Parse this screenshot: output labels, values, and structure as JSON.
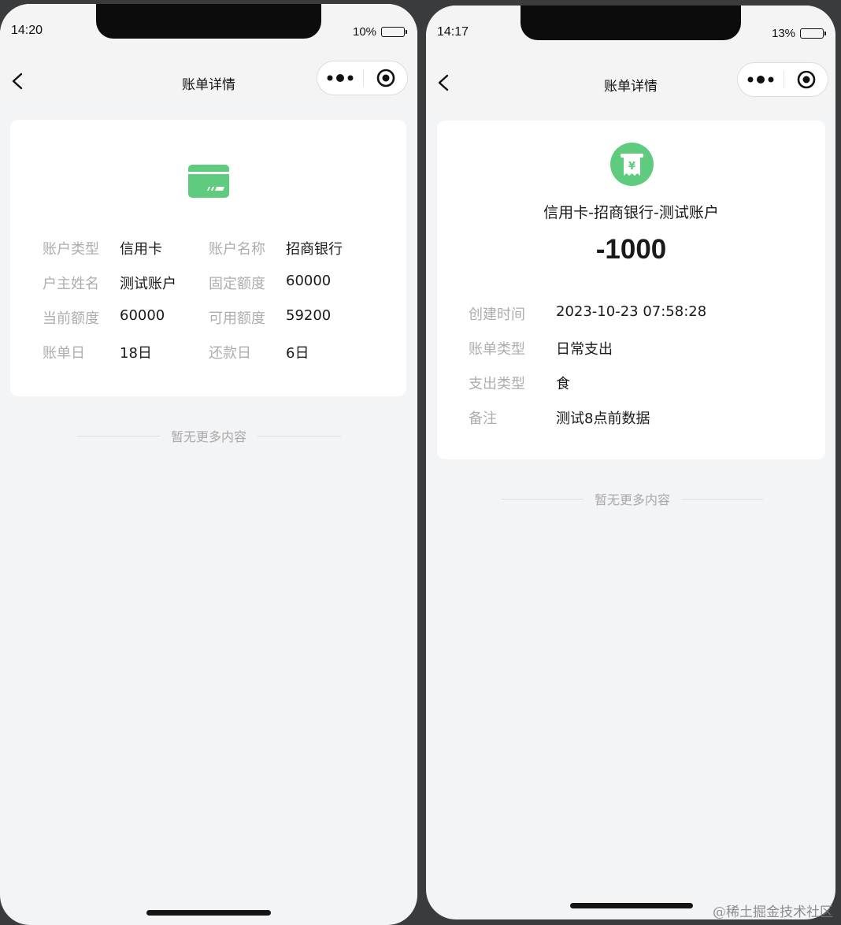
{
  "left": {
    "status": {
      "time": "14:20",
      "battery_pct": "10%",
      "battery_level": 0.1
    },
    "nav": {
      "title": "账单详情"
    },
    "card_icon": "credit-card-icon",
    "info": [
      {
        "label": "账户类型",
        "value": "信用卡"
      },
      {
        "label": "账户名称",
        "value": "招商银行"
      },
      {
        "label": "户主姓名",
        "value": "测试账户"
      },
      {
        "label": "固定额度",
        "value": "60000"
      },
      {
        "label": "当前额度",
        "value": "60000"
      },
      {
        "label": "可用额度",
        "value": "59200"
      },
      {
        "label": "账单日",
        "value": "18日"
      },
      {
        "label": "还款日",
        "value": "6日"
      }
    ],
    "footer": "暂无更多内容"
  },
  "right": {
    "status": {
      "time": "14:17",
      "battery_pct": "13%",
      "battery_level": 0.13
    },
    "nav": {
      "title": "账单详情"
    },
    "bill_icon": "yen-receipt-icon",
    "account_name": "信用卡-招商银行-测试账户",
    "amount": "-1000",
    "info": [
      {
        "label": "创建时间",
        "value": "2023-10-23 07:58:28"
      },
      {
        "label": "账单类型",
        "value": "日常支出"
      },
      {
        "label": "支出类型",
        "value": "食"
      },
      {
        "label": "备注",
        "value": "测试8点前数据"
      }
    ],
    "footer": "暂无更多内容"
  },
  "watermark": "@稀土掘金技术社区",
  "colors": {
    "accent": "#5ecb7f",
    "background": "#f3f4f6"
  }
}
